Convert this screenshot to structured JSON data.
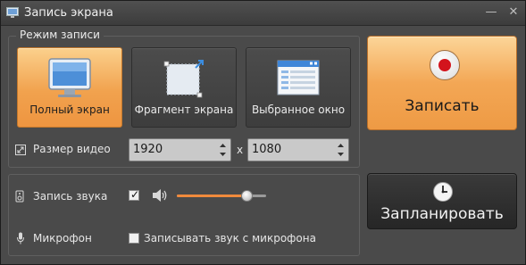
{
  "window": {
    "title": "Запись экрана"
  },
  "mode_group": {
    "legend": "Режим записи",
    "tiles": [
      {
        "label": "Полный экран",
        "icon": "monitor-icon",
        "selected": true
      },
      {
        "label": "Фрагмент экрана",
        "icon": "screen-fragment-icon",
        "selected": false
      },
      {
        "label": "Выбранное окно",
        "icon": "selected-window-icon",
        "selected": false
      }
    ]
  },
  "video_size": {
    "label": "Размер видео",
    "width": "1920",
    "separator": "x",
    "height": "1080"
  },
  "audio": {
    "sound_label": "Запись звука",
    "sound_checked": true,
    "volume_level": 0.78,
    "mic_label": "Микрофон",
    "mic_checkbox_label": "Записывать звук с микрофона",
    "mic_checked": false
  },
  "actions": {
    "record_label": "Записать",
    "schedule_label": "Запланировать"
  },
  "colors": {
    "accent_orange": "#f3a755",
    "record_red": "#d3141c",
    "slider_fill": "#f08a3c"
  }
}
